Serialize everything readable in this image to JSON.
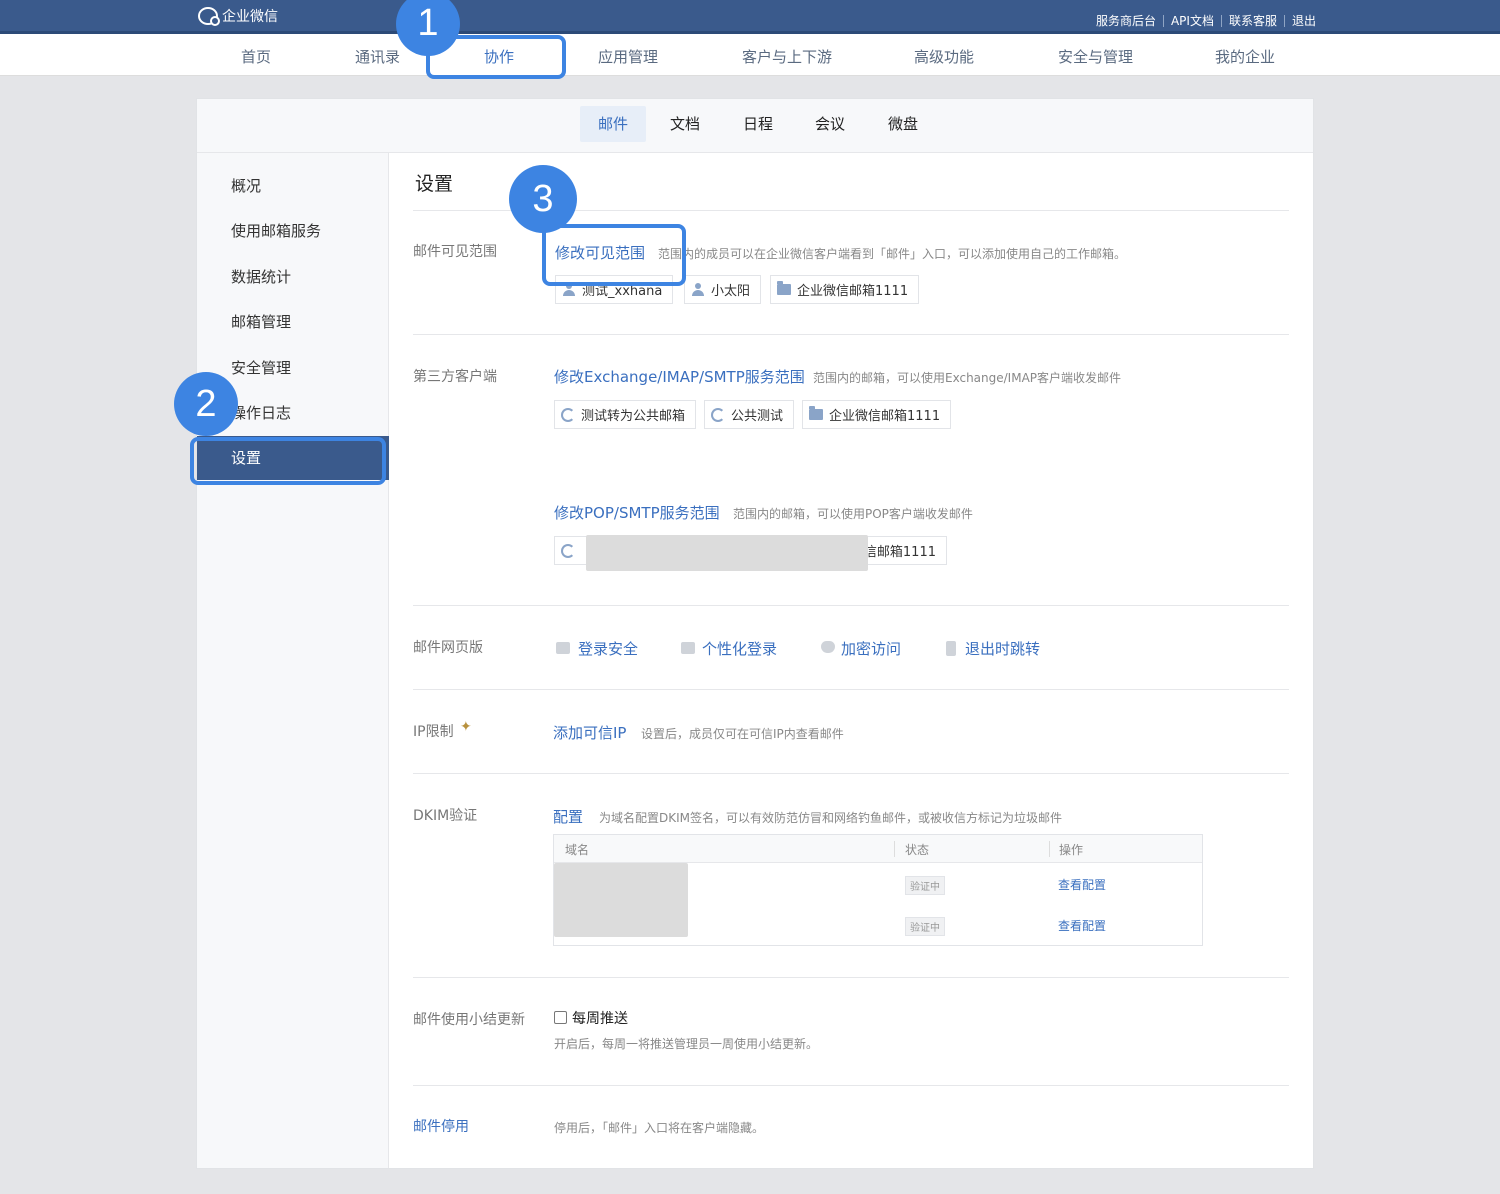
{
  "topbar": {
    "logo": "企业微信",
    "links": [
      "服务商后台",
      "API文档",
      "联系客服",
      "退出"
    ]
  },
  "mainnav": [
    "首页",
    "通讯录",
    "协作",
    "应用管理",
    "客户与上下游",
    "高级功能",
    "安全与管理",
    "我的企业"
  ],
  "subnav": [
    "邮件",
    "文档",
    "日程",
    "会议",
    "微盘"
  ],
  "sidebar": [
    "概况",
    "使用邮箱服务",
    "数据统计",
    "邮箱管理",
    "安全管理",
    "操作日志",
    "设置"
  ],
  "content": {
    "title": "设置",
    "visibility": {
      "label": "邮件可见范围",
      "link": "修改可见范围",
      "desc": "范围内的成员可以在企业微信客户端看到「邮件」入口，可以添加使用自己的工作邮箱。",
      "chips": [
        "测试_xxhana",
        "小太阳",
        "企业微信邮箱1111"
      ]
    },
    "thirdparty": {
      "label": "第三方客户端",
      "imap_link": "修改Exchange/IMAP/SMTP服务范围",
      "imap_desc": "范围内的邮箱，可以使用Exchange/IMAP客户端收发邮件",
      "imap_chips": [
        "测试转为公共邮箱",
        "公共测试",
        "企业微信邮箱1111"
      ],
      "pop_link": "修改POP/SMTP服务范围",
      "pop_desc": "范围内的邮箱，可以使用POP客户端收发邮件",
      "pop_chip_tail": "信邮箱1111"
    },
    "web": {
      "label": "邮件网页版",
      "items": [
        "登录安全",
        "个性化登录",
        "加密访问",
        "退出时跳转"
      ]
    },
    "ip": {
      "label": "IP限制",
      "link": "添加可信IP",
      "desc": "设置后，成员仅可在可信IP内查看邮件"
    },
    "dkim": {
      "label": "DKIM验证",
      "link": "配置",
      "desc": "为域名配置DKIM签名，可以有效防范仿冒和网络钓鱼邮件，或被收信方标记为垃圾邮件",
      "columns": [
        "域名",
        "状态",
        "操作"
      ],
      "rows": [
        {
          "status": "验证中",
          "action": "查看配置"
        },
        {
          "status": "验证中",
          "action": "查看配置"
        }
      ]
    },
    "summary": {
      "label": "邮件使用小结更新",
      "checkbox": "每周推送",
      "desc": "开启后，每周一将推送管理员一周使用小结更新。"
    },
    "disable": {
      "link": "邮件停用",
      "desc": "停用后，「邮件」入口将在客户端隐藏。"
    }
  },
  "annotations": [
    "1",
    "2",
    "3"
  ]
}
